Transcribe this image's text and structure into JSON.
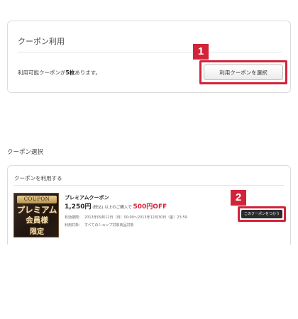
{
  "usage_panel": {
    "title": "クーポン利用",
    "available_prefix": "利用可能クーポンが",
    "available_count": "5枚",
    "available_suffix": "あります。",
    "select_button_label": "利用クーポンを選択",
    "step_badge": "1"
  },
  "selection_section": {
    "label": "クーポン選択",
    "panel_title": "クーポンを利用する",
    "step_badge": "2",
    "coupon": {
      "image_tag": "COUPON",
      "image_line1": "プレミアム",
      "image_line2": "会員様",
      "image_line3": "限定",
      "name": "プレミアムクーポン",
      "condition_amount": "1,250円",
      "condition_text": "(税込) 以上のご購入で",
      "discount": "500円OFF",
      "period_label": "有効期限：",
      "period_value": "2013年09月11日（月）00:00～2013年12月30日（金）23:59",
      "target_label": "利用対象：",
      "target_value": "すべてのショップ対象商品対象",
      "use_button_label": "このクーポンをつかう"
    }
  },
  "colors": {
    "highlight": "#d2233a",
    "use_button_bg": "#2b2b2b"
  }
}
